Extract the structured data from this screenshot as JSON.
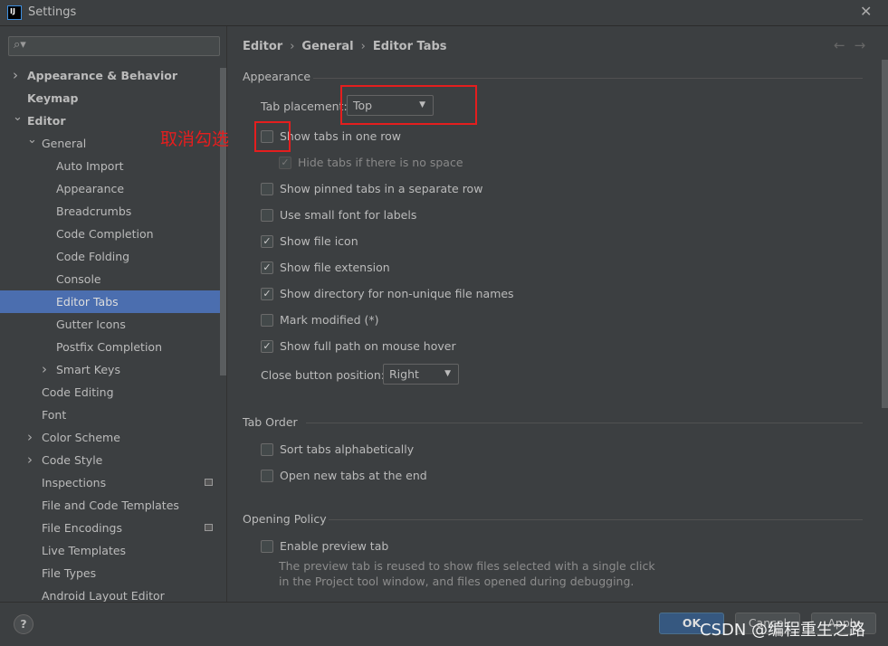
{
  "window": {
    "title": "Settings",
    "logo": "IJ",
    "close_icon": "close-icon"
  },
  "sidebar": {
    "search_placeholder": "",
    "items": [
      {
        "label": "Appearance & Behavior",
        "level": 0,
        "bold": true,
        "chevron": "right"
      },
      {
        "label": "Keymap",
        "level": 0,
        "bold": true
      },
      {
        "label": "Editor",
        "level": 0,
        "bold": true,
        "chevron": "down"
      },
      {
        "label": "General",
        "level": 1,
        "chevron": "down"
      },
      {
        "label": "Auto Import",
        "level": 2
      },
      {
        "label": "Appearance",
        "level": 2
      },
      {
        "label": "Breadcrumbs",
        "level": 2
      },
      {
        "label": "Code Completion",
        "level": 2
      },
      {
        "label": "Code Folding",
        "level": 2
      },
      {
        "label": "Console",
        "level": 2
      },
      {
        "label": "Editor Tabs",
        "level": 2,
        "selected": true
      },
      {
        "label": "Gutter Icons",
        "level": 2
      },
      {
        "label": "Postfix Completion",
        "level": 2
      },
      {
        "label": "Smart Keys",
        "level": 2,
        "chevron": "right"
      },
      {
        "label": "Code Editing",
        "level": 1
      },
      {
        "label": "Font",
        "level": 1
      },
      {
        "label": "Color Scheme",
        "level": 1,
        "chevron": "right"
      },
      {
        "label": "Code Style",
        "level": 1,
        "chevron": "right"
      },
      {
        "label": "Inspections",
        "level": 1,
        "badge": true
      },
      {
        "label": "File and Code Templates",
        "level": 1
      },
      {
        "label": "File Encodings",
        "level": 1,
        "badge": true
      },
      {
        "label": "Live Templates",
        "level": 1
      },
      {
        "label": "File Types",
        "level": 1
      },
      {
        "label": "Android Layout Editor",
        "level": 1
      }
    ]
  },
  "breadcrumb": [
    "Editor",
    "General",
    "Editor Tabs"
  ],
  "sections": {
    "appearance": "Appearance",
    "tab_order": "Tab Order",
    "opening_policy": "Opening Policy"
  },
  "tab_placement": {
    "label": "Tab placement:",
    "value": "Top"
  },
  "checkboxes": [
    {
      "label": "Show tabs in one row",
      "checked": false
    },
    {
      "label": "Hide tabs if there is no space",
      "checked": true,
      "disabled": true
    },
    {
      "label": "Show pinned tabs in a separate row",
      "checked": false
    },
    {
      "label": "Use small font for labels",
      "checked": false
    },
    {
      "label": "Show file icon",
      "checked": true
    },
    {
      "label": "Show file extension",
      "checked": true
    },
    {
      "label": "Show directory for non-unique file names",
      "checked": true
    },
    {
      "label": "Mark modified (*)",
      "checked": false
    },
    {
      "label": "Show full path on mouse hover",
      "checked": true
    }
  ],
  "close_button": {
    "label": "Close button position:",
    "value": "Right"
  },
  "tab_order": [
    {
      "label": "Sort tabs alphabetically",
      "checked": false
    },
    {
      "label": "Open new tabs at the end",
      "checked": false
    }
  ],
  "opening": {
    "label": "Enable preview tab",
    "checked": false,
    "desc1": "The preview tab is reused to show files selected with a single click",
    "desc2": "in the Project tool window, and files opened during debugging."
  },
  "annotation": "取消勾选",
  "buttons": {
    "help": "?",
    "ok": "OK",
    "cancel": "Cancel",
    "apply": "Apply"
  },
  "watermark": "CSDN @编程重生之路",
  "colors": {
    "selection": "#4b6eaf",
    "annotation": "#e41e1e",
    "ok_button": "#365880"
  }
}
